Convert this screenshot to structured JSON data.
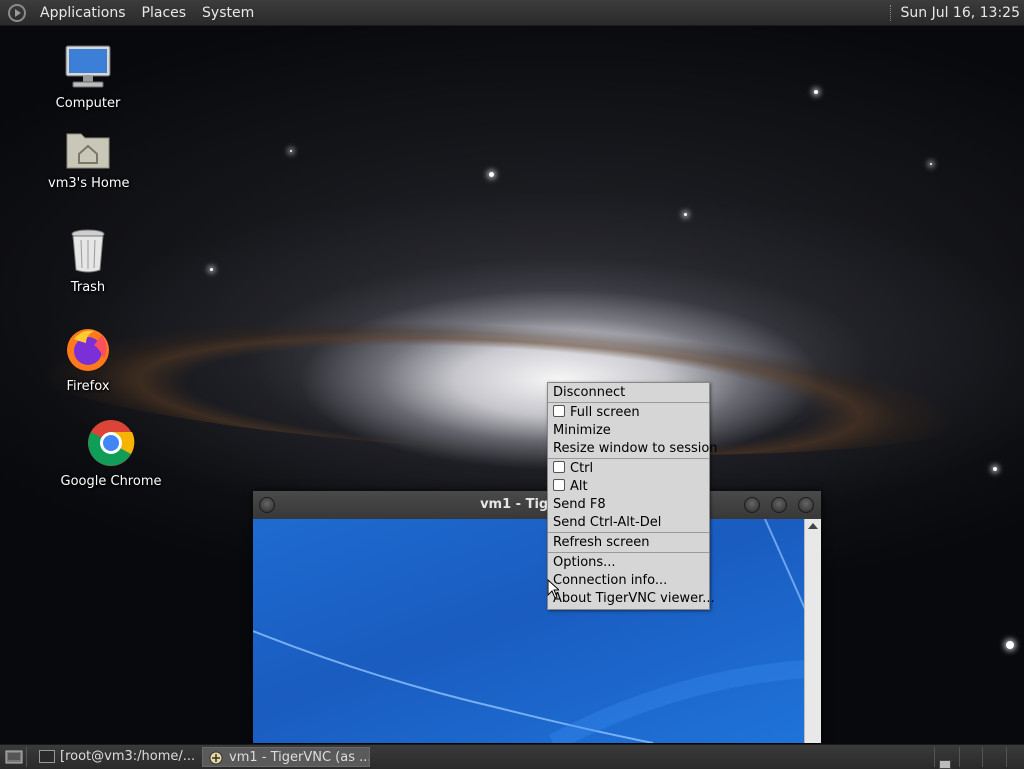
{
  "top_panel": {
    "menus": [
      "Applications",
      "Places",
      "System"
    ],
    "clock": "Sun Jul 16, 13:25"
  },
  "desktop": {
    "icons": [
      {
        "label": "Computer",
        "icon": "computer-icon"
      },
      {
        "label": "vm3's Home",
        "icon": "home-folder-icon"
      },
      {
        "label": "Trash",
        "icon": "trash-icon"
      },
      {
        "label": "Firefox",
        "icon": "firefox-icon"
      },
      {
        "label": "Google Chrome",
        "icon": "chrome-icon"
      }
    ]
  },
  "vnc_window": {
    "title": "vm1 - TigerVNC"
  },
  "context_menu": {
    "items": [
      {
        "label": "Disconnect",
        "checkbox": false,
        "divider_after": true
      },
      {
        "label": "Full screen",
        "checkbox": true,
        "checked": false,
        "divider_after": false
      },
      {
        "label": "Minimize",
        "checkbox": false,
        "divider_after": false
      },
      {
        "label": "Resize window to session",
        "checkbox": false,
        "divider_after": true
      },
      {
        "label": "Ctrl",
        "checkbox": true,
        "checked": false,
        "divider_after": false
      },
      {
        "label": "Alt",
        "checkbox": true,
        "checked": false,
        "divider_after": false
      },
      {
        "label": "Send F8",
        "checkbox": false,
        "divider_after": false
      },
      {
        "label": "Send Ctrl-Alt-Del",
        "checkbox": false,
        "divider_after": true
      },
      {
        "label": "Refresh screen",
        "checkbox": false,
        "divider_after": true
      },
      {
        "label": "Options...",
        "checkbox": false,
        "divider_after": false
      },
      {
        "label": "Connection info...",
        "checkbox": false,
        "divider_after": false
      },
      {
        "label": "About TigerVNC viewer...",
        "checkbox": false,
        "divider_after": false
      }
    ]
  },
  "bottom_panel": {
    "tasks": [
      {
        "label": "[root@vm3:/home/...",
        "active": false
      },
      {
        "label": "vm1 - TigerVNC (as ...",
        "active": true
      }
    ]
  },
  "colors": {
    "panel_bg": "#2f2f2f",
    "menu_bg": "#d6d6d6",
    "vnc_desktop_blue": "#1e6bd0"
  }
}
